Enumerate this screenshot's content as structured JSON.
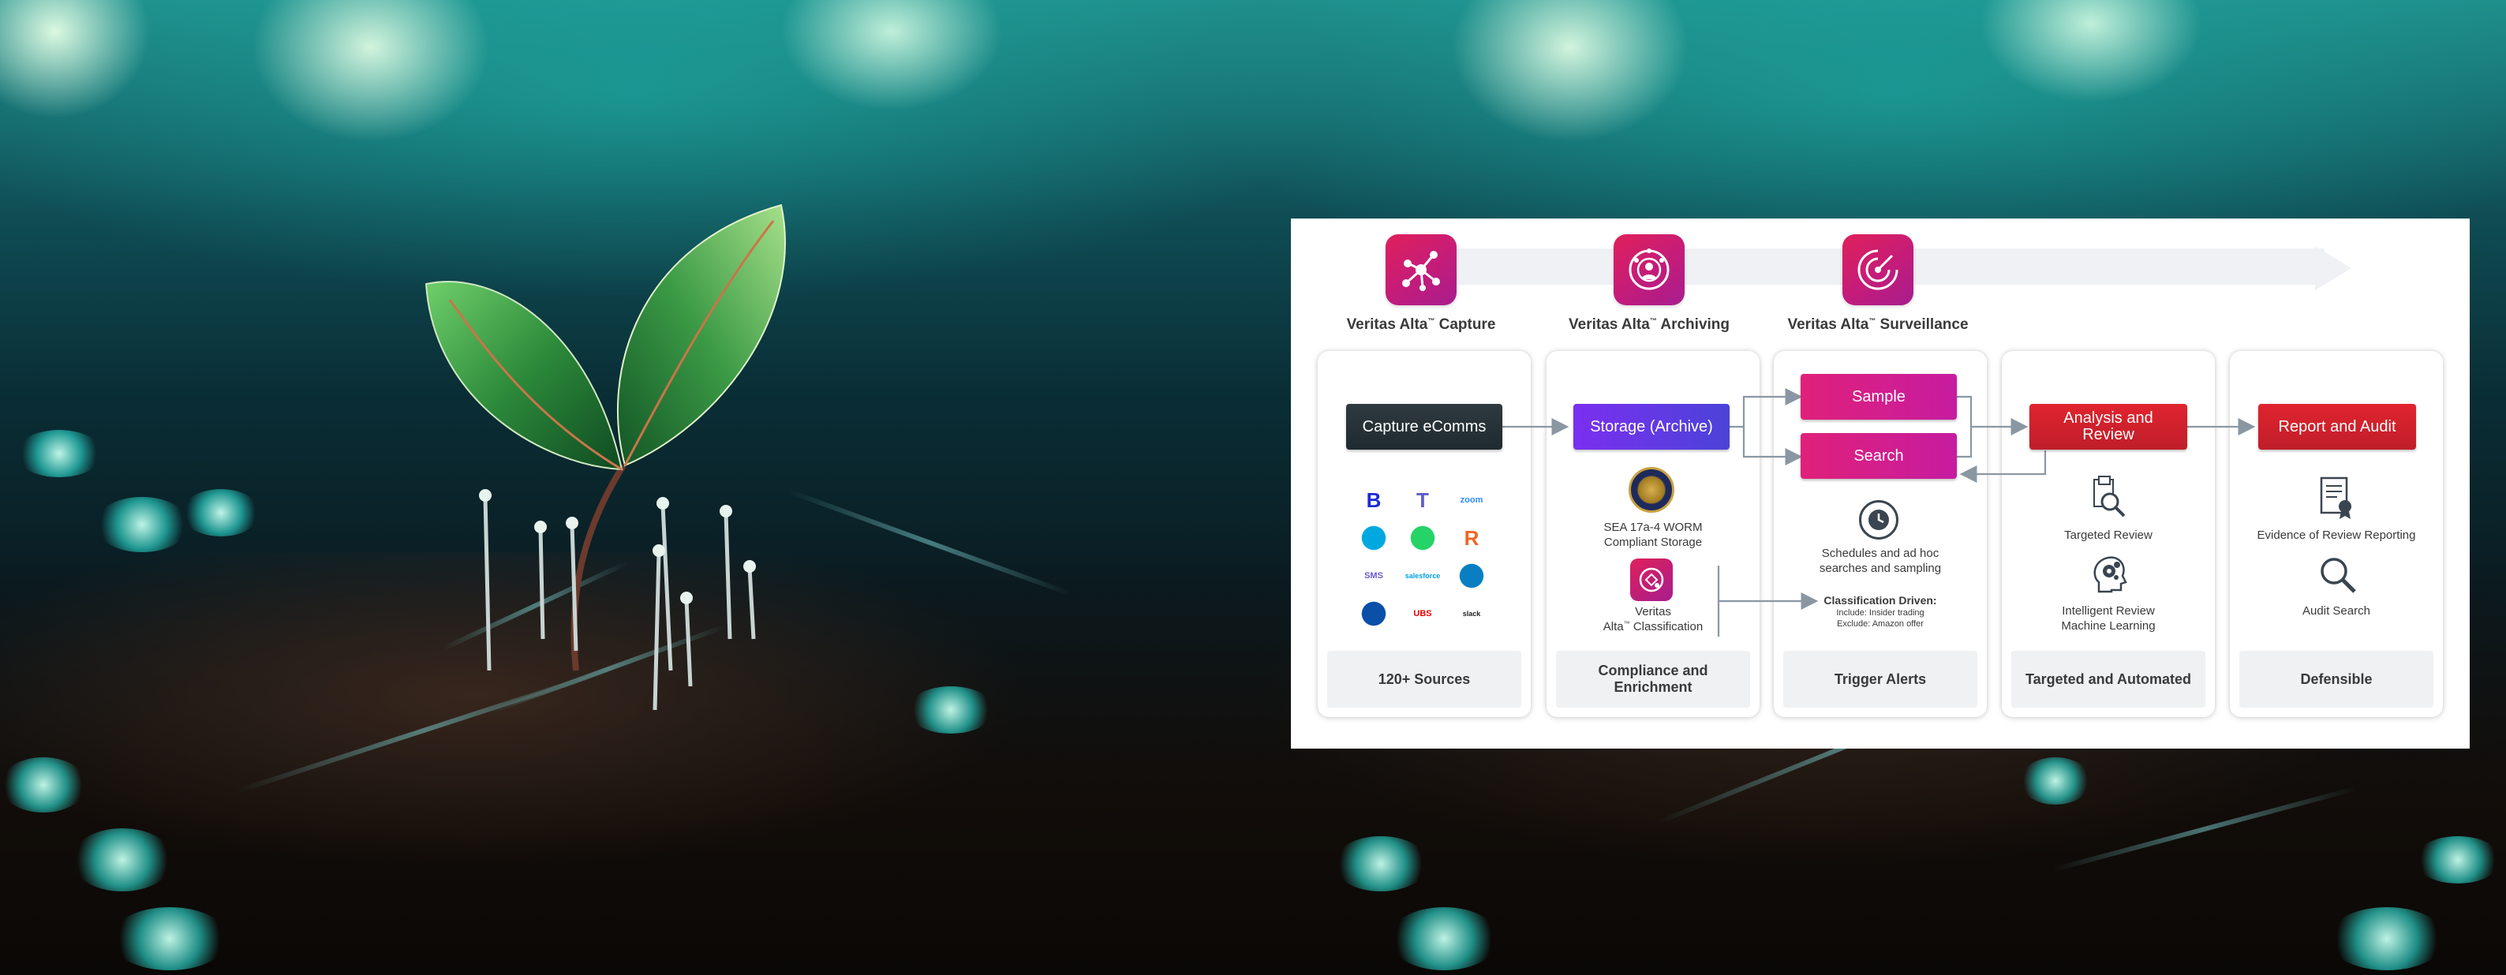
{
  "products": [
    {
      "name": "Veritas Alta",
      "suffix": " Capture",
      "icon": "network-nodes-icon"
    },
    {
      "name": "Veritas Alta",
      "suffix": " Archiving",
      "icon": "archive-people-icon"
    },
    {
      "name": "Veritas Alta",
      "suffix": " Surveillance",
      "icon": "radar-sweep-icon"
    }
  ],
  "trademark": "™",
  "steps": {
    "capture": {
      "label": "Capture eComms",
      "footer": "120+ Sources"
    },
    "storage": {
      "label": "Storage (Archive)",
      "footer_line1": "Compliance and",
      "footer_line2": "Enrichment"
    },
    "sample": {
      "label": "Sample"
    },
    "search": {
      "label": "Search"
    },
    "surveillance_footer": "Trigger Alerts",
    "analysis": {
      "label_line1": "Analysis and",
      "label_line2": "Review",
      "footer": "Targeted and Automated"
    },
    "report": {
      "label": "Report and Audit",
      "footer": "Defensible"
    }
  },
  "compliance": {
    "sec_line1": "SEA 17a-4 WORM",
    "sec_line2": "Compliant Storage",
    "classification_line1": "Veritas",
    "classification_line2": "Alta",
    "classification_line3": " Classification"
  },
  "surveillance": {
    "schedule_line1": "Schedules and ad hoc",
    "schedule_line2": "searches and sampling",
    "classification_title": "Classification Driven:",
    "include": "Include: Insider trading",
    "exclude": "Exclude: Amazon offer"
  },
  "analysis": {
    "targeted": "Targeted Review",
    "intelligent_line1": "Intelligent Review",
    "intelligent_line2": "Machine Learning"
  },
  "report": {
    "evidence": "Evidence of Review Reporting",
    "audit": "Audit Search"
  },
  "source_logos": [
    {
      "name": "bloomberg-logo",
      "text": "B",
      "color": "#1b2bd6"
    },
    {
      "name": "teams-logo",
      "text": "T",
      "color": "#5b5fc7"
    },
    {
      "name": "zoom-logo",
      "text": "zoom",
      "color": "#2d8cff"
    },
    {
      "name": "att-logo",
      "text": "",
      "color": "#00a8e0"
    },
    {
      "name": "whatsapp-logo",
      "text": "",
      "color": "#25d366"
    },
    {
      "name": "r-logo",
      "text": "R",
      "color": "#f26522"
    },
    {
      "name": "sms-logo",
      "text": "SMS",
      "color": "#6a5acd"
    },
    {
      "name": "salesforce-logo",
      "text": "salesforce",
      "color": "#00a1e0"
    },
    {
      "name": "webex-logo",
      "text": "",
      "color": "#0a7ec2"
    },
    {
      "name": "onedrive-logo",
      "text": "",
      "color": "#0a4fa8"
    },
    {
      "name": "ubs-logo",
      "text": "UBS",
      "color": "#e60000"
    },
    {
      "name": "slack-logo",
      "text": "slack",
      "color": "#222222"
    }
  ],
  "colors": {
    "magenta": "#c41c7a",
    "red": "#d2222d",
    "purple": "#6a39e6",
    "dark": "#26323a",
    "connector": "#8a97a3"
  }
}
